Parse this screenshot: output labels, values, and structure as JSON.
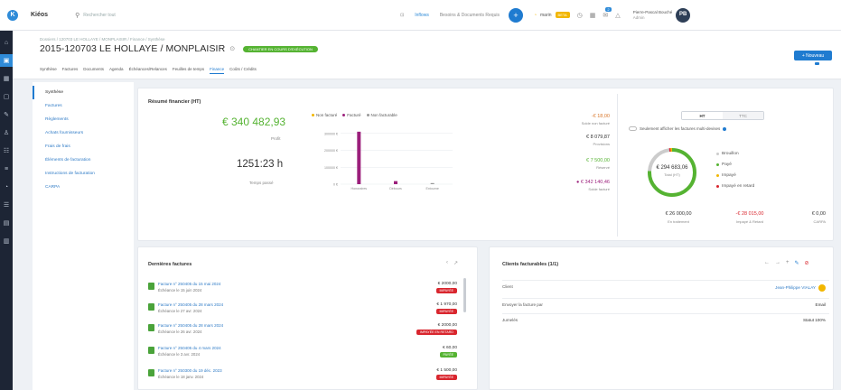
{
  "app": {
    "name": "Kiéos",
    "logo": "K"
  },
  "topbar": {
    "search_placeholder": "Rechercher tout",
    "link1": "Inflows",
    "link2": "Besoins & Documents Requis",
    "plus": "+",
    "account_label": "marin",
    "account_badge": "BETA",
    "notif_count": "2",
    "user_name": "Pierre-Pascal Bouché",
    "user_sub": "Admin",
    "user_initials": "PB"
  },
  "sidebar": {
    "items": [
      "⌂",
      "▣",
      "▦",
      "▢",
      "✎",
      "♙",
      "☷",
      "≡",
      "◔",
      "☰",
      "▤",
      "▥"
    ]
  },
  "header": {
    "breadcrumb": "Dossiers / 120703 LE HOLLAYE / MONPLAISIR / Finance / Synthèse",
    "title": "2015-120703 LE HOLLAYE / MONPLAISIR",
    "status": "CHANTIER EN COURS D'EXÉCUTION",
    "new_button": "+ Nouveau",
    "tabs": [
      "Synthèse",
      "Factures",
      "Documents",
      "Agenda",
      "Échéances/Relances",
      "Feuilles de temps",
      "Finance",
      "Coûts / Crédits"
    ],
    "active_tab": "Finance"
  },
  "leftnav": {
    "items": [
      "Synthèse",
      "Factures",
      "Règlements",
      "Achats fournisseurs",
      "Frais de frais",
      "Éléments de facturation",
      "Instructions de facturation",
      "CARPA"
    ]
  },
  "summary": {
    "title": "Résumé financier (HT)",
    "amount": "€ 340 482,93",
    "amount_label": "Profit",
    "time": "1251:23 h",
    "time_label": "Temps passé",
    "legend": [
      "Non facturé",
      "Facturé",
      "Non facturable"
    ],
    "legend_colors": [
      "#f2b600",
      "#9b1f7b",
      "#999999"
    ],
    "yticks": [
      "300000 €",
      "200000 €",
      "100000 €",
      "0 €"
    ],
    "xticks": [
      "Honoraires",
      "Débours",
      "Extourne"
    ],
    "chart_data": {
      "type": "bar",
      "categories": [
        "Honoraires",
        "Débours",
        "Extourne"
      ],
      "series": [
        {
          "name": "Non facturé",
          "values": [
            0,
            0,
            0
          ]
        },
        {
          "name": "Facturé",
          "values": [
            310000,
            18000,
            0
          ]
        },
        {
          "name": "Non facturable",
          "values": [
            0,
            0,
            2000
          ]
        }
      ],
      "ylim": [
        0,
        320000
      ]
    },
    "right_values": [
      {
        "value": "-€ 18,00",
        "label": "Solde non facturé",
        "color": "#d9762a"
      },
      {
        "value": "€ 8 079,87",
        "label": "Provisions",
        "color": "#333333"
      },
      {
        "value": "€ 7 500,00",
        "label": "Réservé",
        "color": "#55b332"
      },
      {
        "value": "● € 342 140,46",
        "label": "Solde facturé",
        "color": "#9b1f7b"
      }
    ]
  },
  "donut": {
    "seg_on": "HT",
    "seg_off": "TTC",
    "toggle_label": "Seulement afficher les factures multi-devises",
    "center_value": "€ 294 683,06",
    "center_label": "Total (HT)",
    "legend": [
      {
        "label": "Brouillon",
        "color": "#cccccc"
      },
      {
        "label": "Payé",
        "color": "#55b332"
      },
      {
        "label": "Impayé",
        "color": "#f2b600"
      },
      {
        "label": "Impayé en retard",
        "color": "#d9262e"
      }
    ],
    "chart_data": {
      "type": "pie",
      "labels": [
        "Payé",
        "Brouillon",
        "Impayé en retard",
        "Impayé"
      ],
      "values": [
        76,
        22,
        1,
        1
      ]
    },
    "footer": [
      {
        "value": "€ 26 000,00",
        "label": "En traitement",
        "color": "#333333"
      },
      {
        "value": "-€ 28 015,00",
        "label": "Impayé & Retard",
        "color": "#d9262e"
      },
      {
        "value": "€ 0,00",
        "label": "CARPA",
        "color": "#333333"
      }
    ]
  },
  "invoices": {
    "title": "Dernières factures",
    "items": [
      {
        "title": "Facture n° 250405 du 15 mai 2024",
        "sub": "Échéance le 15 juin 2024",
        "value": "€ 2000,00",
        "badge": "IMPAYÉE",
        "badge_color": "red"
      },
      {
        "title": "Facture n° 250405 du 28 mars 2024",
        "sub": "Échéance le 27 avr. 2024",
        "value": "€ 1 970,00",
        "badge": "IMPAYÉE",
        "badge_color": "red"
      },
      {
        "title": "Facture n° 250405 du 28 mars 2024",
        "sub": "Échéance le 26 avr. 2024",
        "value": "€ 2000,00",
        "badge": "IMPAYÉE EN RETARD",
        "badge_color": "red"
      },
      {
        "title": "Facture n° 250405 du 4 mars 2024",
        "sub": "Échéance le 3 avr. 2024",
        "value": "€ 60,00",
        "badge": "PAYÉE",
        "badge_color": "green"
      },
      {
        "title": "Facture n° 250300 du 19 déc. 2023",
        "sub": "Échéance le 18 janv. 2024",
        "value": "€ 1 500,00",
        "badge": "IMPAYÉE",
        "badge_color": "red"
      }
    ]
  },
  "clients": {
    "title": "Clients facturables (1/1)",
    "rows": [
      {
        "label": "Client",
        "value": "Jean-Philippe VIALAY"
      },
      {
        "label": "Envoyer la facture par",
        "value": "Email"
      },
      {
        "label": "Jumelés",
        "value": "Statut 100%"
      }
    ]
  }
}
